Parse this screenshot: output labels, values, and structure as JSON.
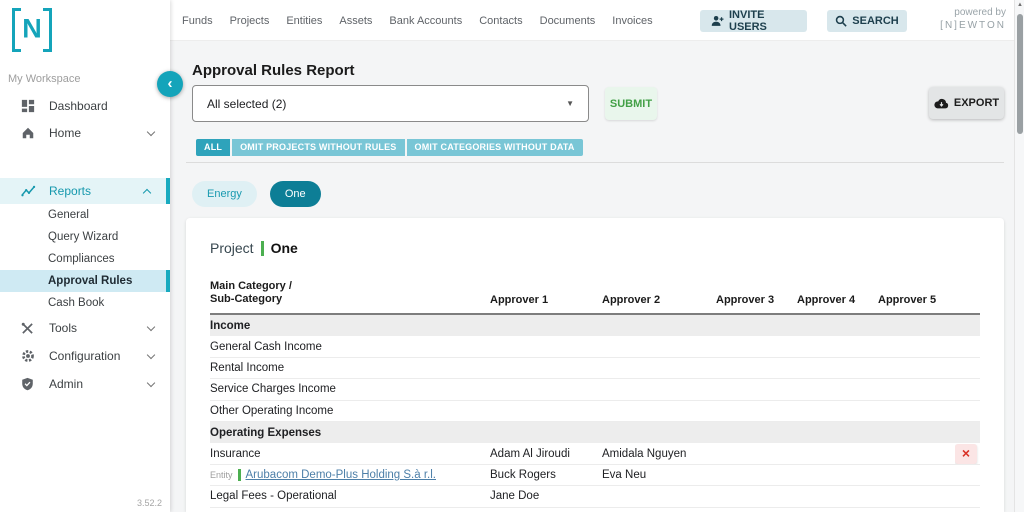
{
  "brand": {
    "logo_text": "N",
    "powered_by": "powered by",
    "powered_brand": "[N]EWTON"
  },
  "colors": {
    "accent": "#14a4ba",
    "accent_dark": "#0d7e96",
    "chip": "#79c6d6",
    "chip_active": "#2ea3bb",
    "submit_green": "#43a047",
    "category_green": "#4caf50",
    "link_blue": "#4d7fa8",
    "remove_red": "#d93025",
    "section_row_bg": "#ededed"
  },
  "topnav": {
    "items": [
      "Funds",
      "Projects",
      "Entities",
      "Assets",
      "Bank Accounts",
      "Contacts",
      "Documents",
      "Invoices"
    ],
    "invite_users_label": "INVITE USERS",
    "search_label": "SEARCH"
  },
  "sidebar": {
    "workspace_label": "My Workspace",
    "items": [
      {
        "label": "Dashboard"
      },
      {
        "label": "Home"
      },
      {
        "label": "Reports"
      },
      {
        "label": "Tools"
      },
      {
        "label": "Configuration"
      },
      {
        "label": "Admin"
      }
    ],
    "reports_children": [
      "General",
      "Query Wizard",
      "Compliances",
      "Approval Rules",
      "Cash Book"
    ],
    "active_child": "Approval Rules",
    "version": "3.52.2"
  },
  "main": {
    "title": "Approval Rules Report",
    "filter_dropdown_value": "All selected (2)",
    "submit_label": "SUBMIT",
    "export_label": "EXPORT",
    "chips": [
      {
        "label": "ALL",
        "active": true
      },
      {
        "label": "OMIT PROJECTS WITHOUT RULES",
        "active": false
      },
      {
        "label": "OMIT CATEGORIES WITHOUT DATA",
        "active": false
      }
    ],
    "tabs": [
      {
        "label": "Energy",
        "active": false
      },
      {
        "label": "One",
        "active": true
      }
    ],
    "report": {
      "project_label": "Project",
      "project_name": "One",
      "columns": [
        "Main Category /\nSub-Category",
        "Approver 1",
        "Approver 2",
        "Approver 3",
        "Approver 4",
        "Approver 5"
      ],
      "rows": [
        {
          "type": "section",
          "label": "Income"
        },
        {
          "type": "item",
          "label": "General Cash Income",
          "approvers": []
        },
        {
          "type": "item",
          "label": "Rental Income",
          "approvers": []
        },
        {
          "type": "item",
          "label": "Service Charges Income",
          "approvers": []
        },
        {
          "type": "item",
          "label": "Other Operating Income",
          "approvers": []
        },
        {
          "type": "section",
          "label": "Operating Expenses"
        },
        {
          "type": "item",
          "label": "Insurance",
          "approvers": [
            "Adam Al Jiroudi",
            "Amidala Nguyen"
          ],
          "removable": true
        },
        {
          "type": "entity",
          "prefix": "Entity",
          "label": "Arubacom Demo-Plus Holding S.à r.l.",
          "approvers": [
            "Buck Rogers",
            "Eva Neu"
          ]
        },
        {
          "type": "item",
          "label": "Legal Fees - Operational",
          "approvers": [
            "Jane Doe"
          ]
        }
      ]
    }
  }
}
